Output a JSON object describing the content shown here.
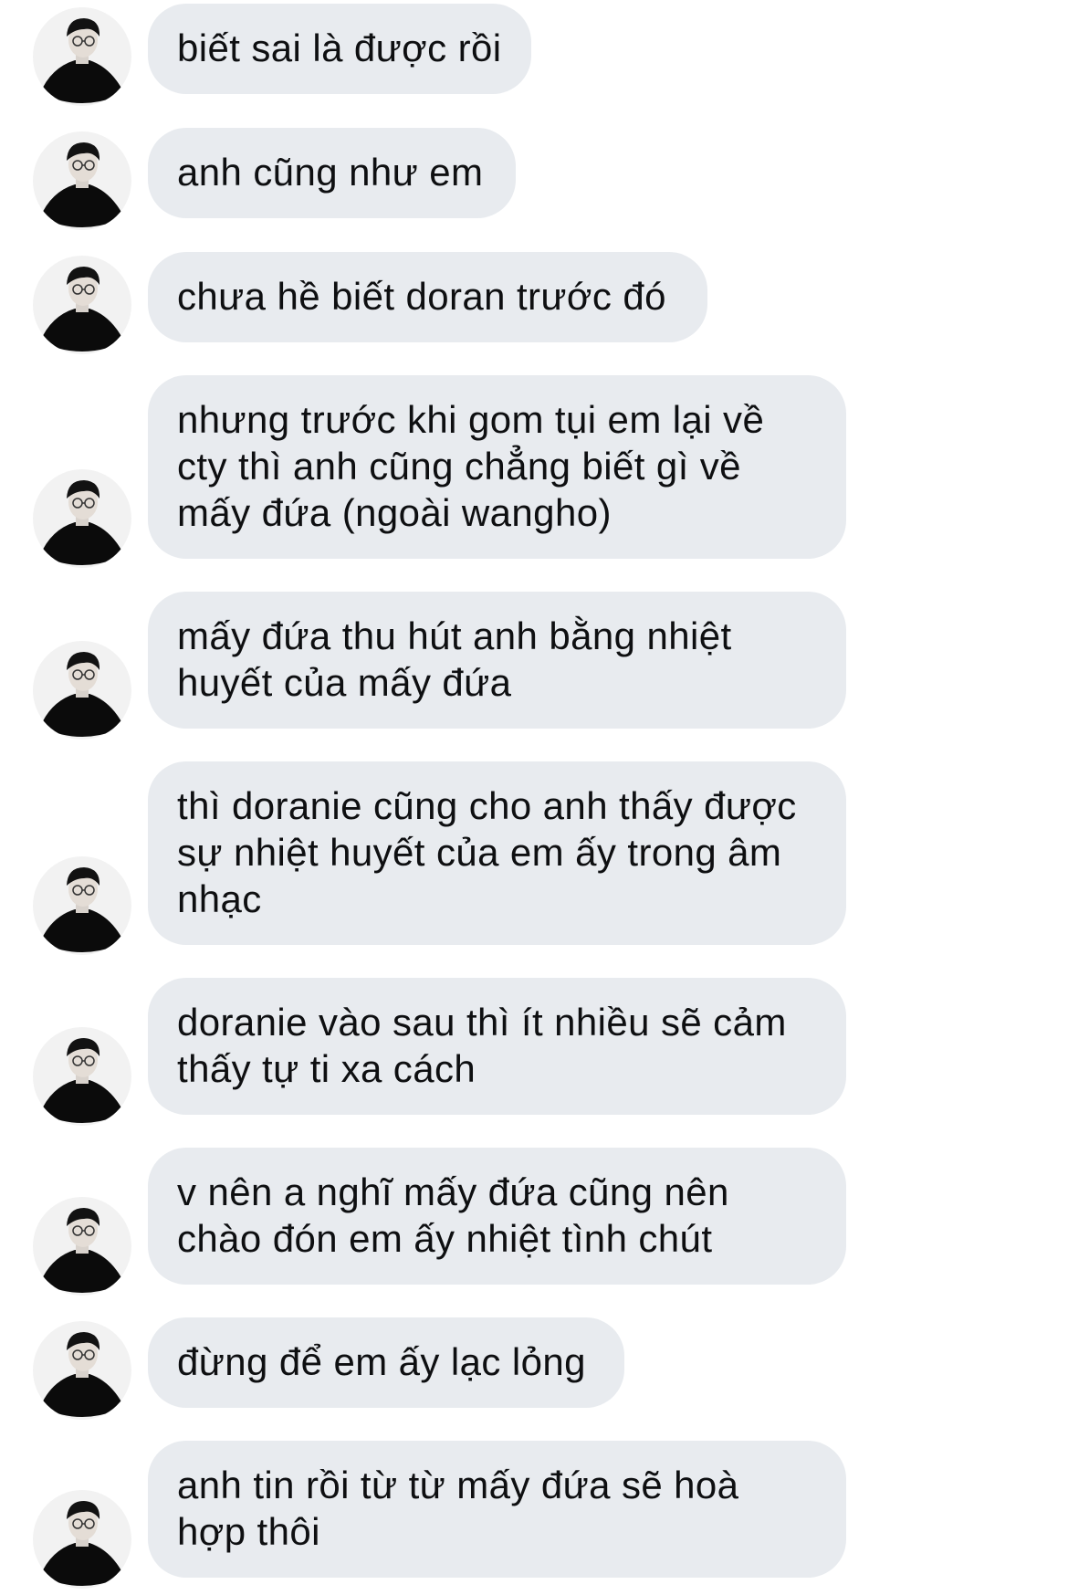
{
  "conversation": {
    "messages": [
      {
        "text": "biết sai là được rồi",
        "avatar_icon": "person-avatar-icon"
      },
      {
        "text": "anh cũng như em",
        "avatar_icon": "person-avatar-icon"
      },
      {
        "text": "chưa hề biết doran trước đó",
        "avatar_icon": "person-avatar-icon"
      },
      {
        "text": "nhưng trước khi gom tụi em lại về\ncty thì anh cũng chẳng biết gì về\nmấy đứa (ngoài wangho)",
        "avatar_icon": "person-avatar-icon"
      },
      {
        "text": "mấy đứa thu hút anh bằng nhiệt\nhuyết của mấy đứa",
        "avatar_icon": "person-avatar-icon"
      },
      {
        "text": "thì doranie cũng cho anh thấy được\nsự nhiệt huyết của em ấy trong âm\nnhạc",
        "avatar_icon": "person-avatar-icon"
      },
      {
        "text": "doranie vào sau thì ít nhiều sẽ cảm\nthấy tự ti xa cách",
        "avatar_icon": "person-avatar-icon"
      },
      {
        "text": "v nên a nghĩ mấy đứa cũng nên\nchào đón em ấy nhiệt tình chút",
        "avatar_icon": "person-avatar-icon"
      },
      {
        "text": "đừng để em ấy lạc lỏng",
        "avatar_icon": "person-avatar-icon"
      },
      {
        "text": "anh tin rồi từ từ mấy đứa sẽ hoà\nhợp thôi",
        "avatar_icon": "person-avatar-icon"
      }
    ]
  },
  "colors": {
    "bubble_background": "#e8ebef",
    "message_text": "#0e0f11",
    "page_background": "#ffffff",
    "avatar_background": "#f2f2f2"
  }
}
